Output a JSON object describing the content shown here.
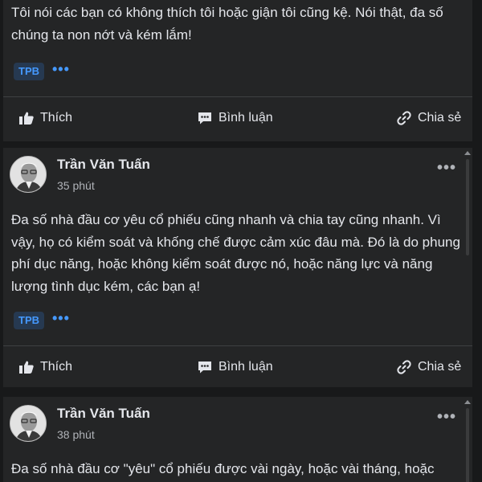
{
  "posts": [
    {
      "text": "Tôi nói các bạn có không thích tôi hoặc giận tôi cũng kệ. Nói thật, đa số chúng ta non nớt và kém lắm!",
      "tag": "TPB",
      "more_tags": "•••"
    },
    {
      "author": "Trần Văn Tuấn",
      "time": "35 phút",
      "more": "•••",
      "text": "Đa số nhà đầu cơ yêu cổ phiếu cũng nhanh và chia tay cũng nhanh. Vì vậy, họ có kiểm soát và khống chế được cảm xúc đâu mà. Đó là do phung phí dục năng, hoặc không kiểm soát được nó, hoặc năng lực và năng lượng tình dục kém, các bạn ạ!",
      "tag": "TPB",
      "more_tags": "•••"
    },
    {
      "author": "Trần Văn Tuấn",
      "time": "38 phút",
      "more": "•••",
      "text": "Đa số nhà đầu cơ \"yêu\" cổ phiếu được vài ngày, hoặc vài tháng, hoặc"
    }
  ],
  "actions": {
    "like": "Thích",
    "comment": "Bình luận",
    "share": "Chia sẻ"
  },
  "colors": {
    "background": "#18191a",
    "card": "#242526",
    "tag_bg": "#263951",
    "tag_text": "#4599ff"
  }
}
